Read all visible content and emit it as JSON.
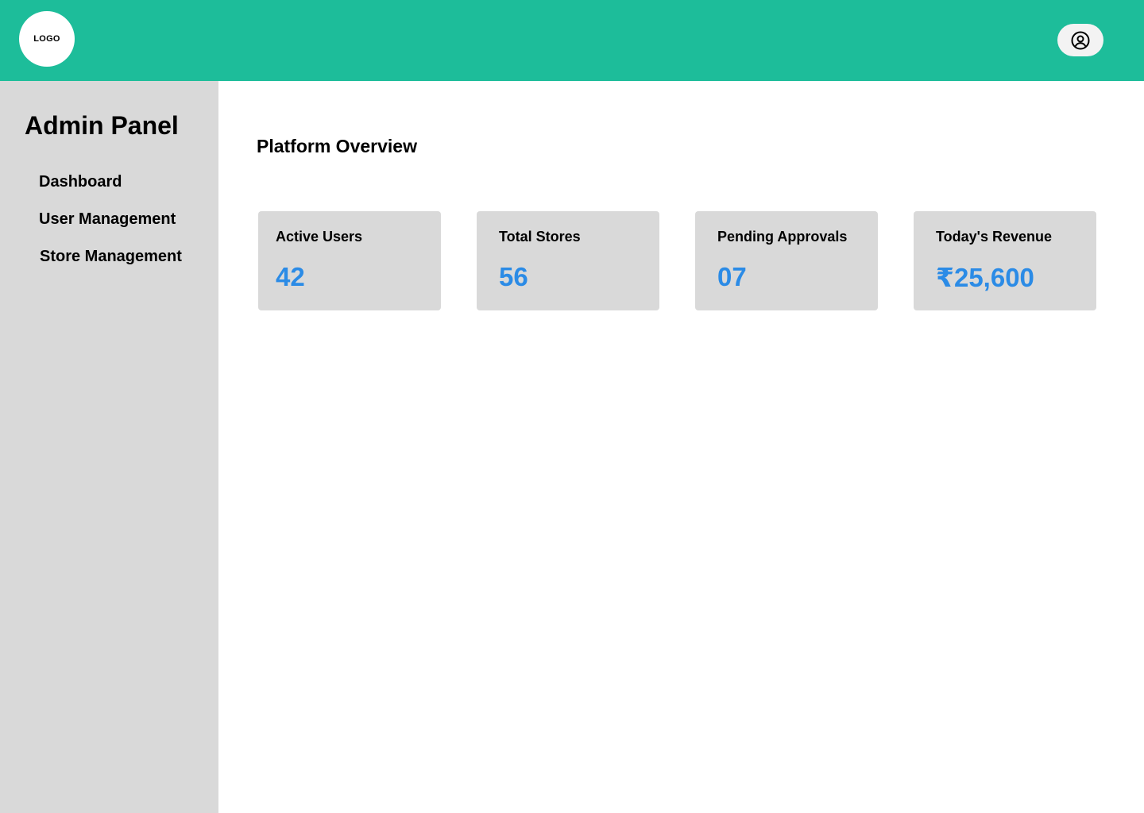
{
  "header": {
    "logo_text": "LOGO",
    "background_color": "#1dbd9a",
    "profile_icon": "user-circle-icon"
  },
  "sidebar": {
    "title": "Admin Panel",
    "background_color": "#d9d9d9",
    "items": [
      {
        "label": "Dashboard"
      },
      {
        "label": "User Management"
      },
      {
        "label": "Store Management"
      }
    ]
  },
  "main": {
    "title": "Platform Overview",
    "value_color": "#2b8be6",
    "cards": [
      {
        "label": "Active Users",
        "value": "42"
      },
      {
        "label": "Total Stores",
        "value": "56"
      },
      {
        "label": "Pending Approvals",
        "value": "07"
      },
      {
        "label": "Today's Revenue",
        "value": "₹25,600"
      }
    ]
  }
}
